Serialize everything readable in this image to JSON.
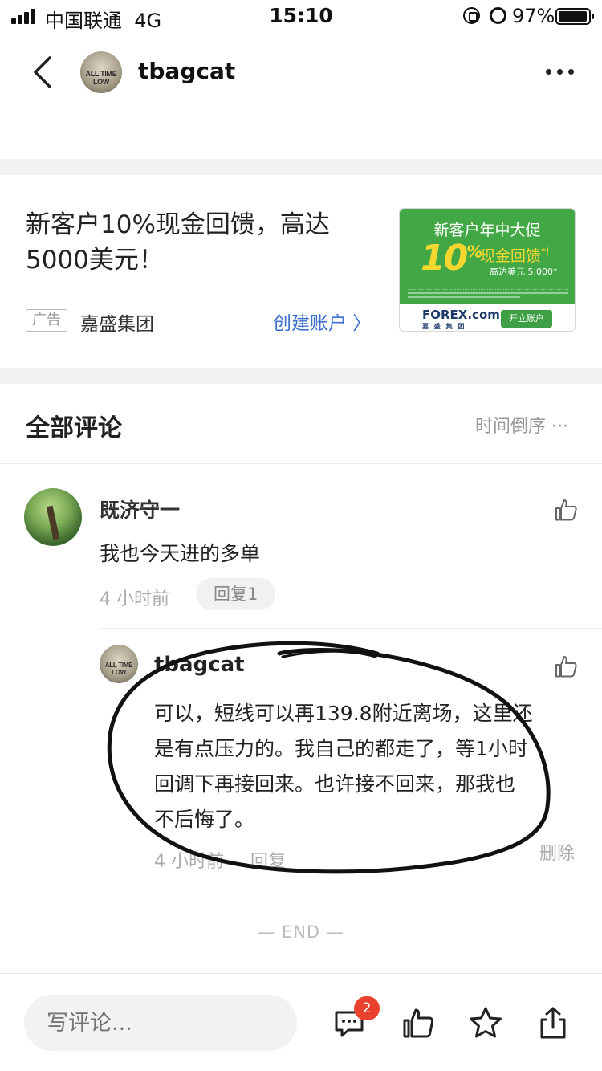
{
  "status_bar": {
    "carrier": "中国联通",
    "network": "4G",
    "time": "15:10",
    "battery": "97%",
    "battery_level": 0.97
  },
  "header": {
    "avatar_text": "ALL TIME LOW",
    "username": "tbagcat"
  },
  "ad": {
    "title": "新客户10%现金回馈，高达5000美元！",
    "label": "广告",
    "advertiser": "嘉盛集团",
    "link_text": "创建账户 〉",
    "banner": {
      "headline": "新客户年中大促",
      "big": "10",
      "pct": "%",
      "sub": "现金回馈",
      "sub_mark": "*!",
      "sub2": "高达美元 5,000*",
      "logo": "FOREX.com",
      "logo_cn": "嘉 盛 集 团",
      "button": "开立账户"
    }
  },
  "comments_section": {
    "title": "全部评论",
    "sort": "时间倒序 ···"
  },
  "comments": [
    {
      "name": "既济守一",
      "text": "我也今天进的多单",
      "time": "4 小时前",
      "reply_button": "回复1"
    }
  ],
  "reply": {
    "avatar_text": "ALL TIME LOW",
    "name": "tbagcat",
    "lines": [
      "可以，短线可以再139.8附近离场，这里还",
      "是有点压力的。我自己的都走了，等1小时",
      "回调下再接回来。也许接不回来，那我也",
      "不后悔了。"
    ],
    "time": "4 小时前",
    "reply_label": "回复",
    "delete_label": "删除"
  },
  "end_text": "— END —",
  "bottom_bar": {
    "placeholder": "写评论...",
    "badge": "2"
  },
  "colors": {
    "link_blue": "#3d6fd1",
    "badge_red": "#e8412e",
    "ad_green": "#42a846",
    "ad_yellow": "#f6d730"
  }
}
